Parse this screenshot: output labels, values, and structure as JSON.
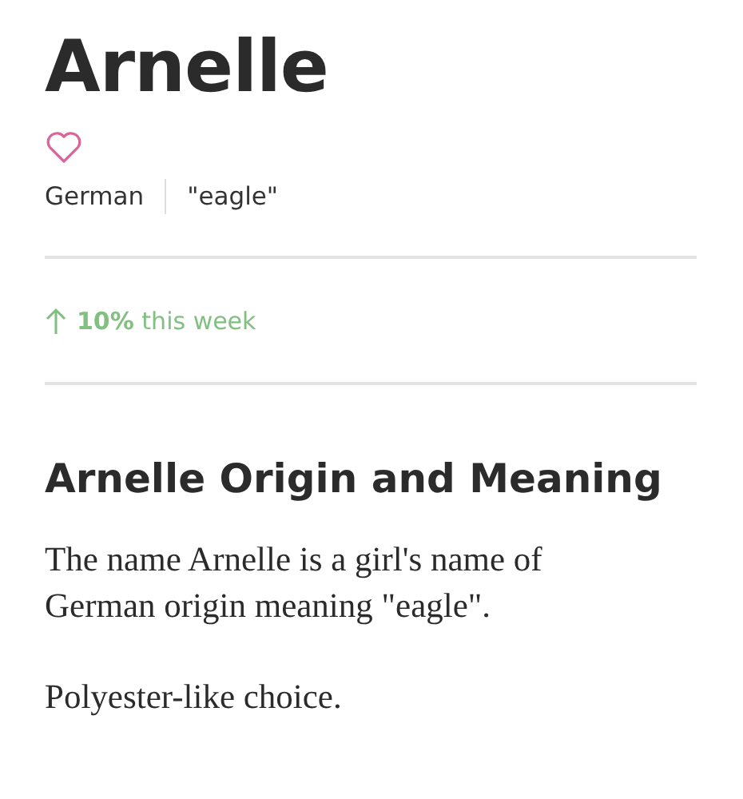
{
  "name": {
    "title": "Arnelle",
    "favorite": false,
    "origin": "German",
    "meaning": "\"eagle\""
  },
  "trend": {
    "rising": true,
    "text": "**10%** this week"
  },
  "section": {
    "heading": "Arnelle Origin and Meaning",
    "paragraphs": [
      "The name Arnelle is a girl's name of German origin meaning \"eagle\".",
      "Polyester-like choice."
    ]
  }
}
